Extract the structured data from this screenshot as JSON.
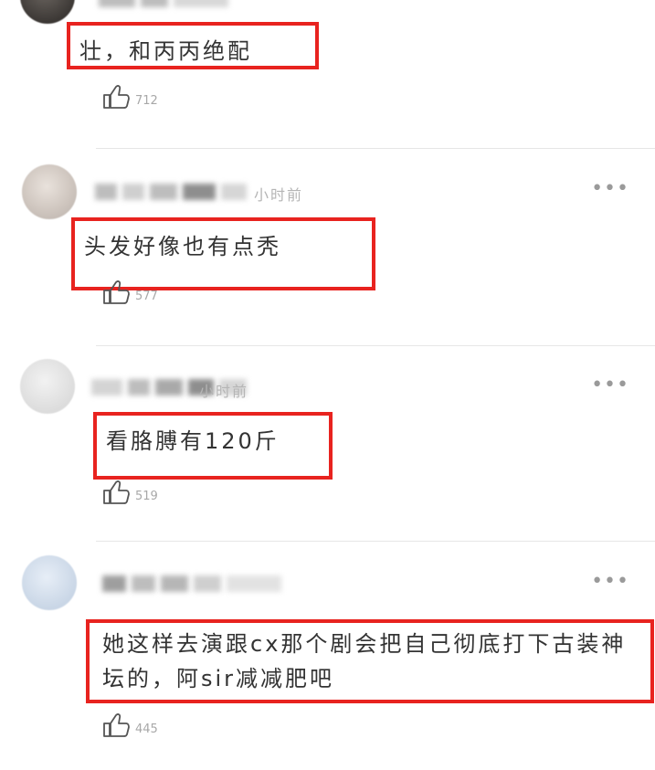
{
  "comments": [
    {
      "text": "壮，和丙丙绝配",
      "likes": "712",
      "time": ""
    },
    {
      "text": "头发好像也有点秃",
      "likes": "577",
      "time": "小时前"
    },
    {
      "text": "看胳膊有120斤",
      "likes": "519",
      "time": "小时前"
    },
    {
      "text": "她这样去演跟cx那个剧会把自己彻底打下古装神坛的，阿sir减减肥吧",
      "likes": "445",
      "time": ""
    }
  ],
  "icons": {
    "like": "thumbs-up-icon",
    "more": "more-dots-icon"
  },
  "colors": {
    "highlight_box": "#e8231f",
    "meta_text": "#b5b5b5",
    "divider": "#e6e6e6"
  }
}
